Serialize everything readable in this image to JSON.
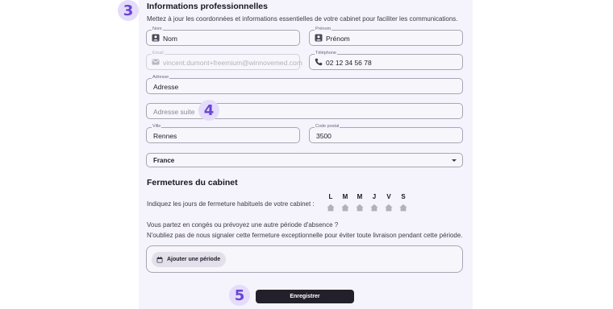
{
  "steps": {
    "s3": "3",
    "s4": "4",
    "s5": "5"
  },
  "section": {
    "title": "Informations professionnelles",
    "subtitle": "Mettez à jour les coordonnées et informations essentielles de votre cabinet pour faciliter les communications."
  },
  "fields": {
    "nom": {
      "label": "Nom",
      "value": "Nom",
      "icon": "person-card-icon"
    },
    "prenom": {
      "label": "Prénom",
      "value": "Prénom",
      "icon": "person-card-icon"
    },
    "email": {
      "label": "Email",
      "value": "vincent.dumont+freemium@winnovemed.com",
      "icon": "mail-icon"
    },
    "telephone": {
      "label": "Téléphone",
      "value": "02 12 34 56 78",
      "icon": "phone-icon"
    },
    "adresse": {
      "label": "Adresse",
      "value": "Adresse"
    },
    "adresse_suite": {
      "placeholder": "Adresse suite"
    },
    "ville": {
      "label": "Ville",
      "value": "Rennes"
    },
    "code_postal": {
      "label": "Code postal",
      "value": "3500"
    },
    "pays": {
      "value": "France"
    }
  },
  "closures": {
    "title": "Fermetures du cabinet",
    "weekly_prompt": "Indiquez les jours de fermeture habituels de votre cabinet :",
    "days": [
      "L",
      "M",
      "M",
      "J",
      "V",
      "S"
    ],
    "absence_line1": "Vous partez en congés ou prévoyez une autre période d'absence ?",
    "absence_line2": "N'oubliez pas de nous signaler cette fermeture exceptionnelle pour éviter toute livraison pendant cette période.",
    "add_period_label": "Ajouter une période"
  },
  "save_label": "Enregistrer",
  "colors": {
    "accent": "#6a45d6",
    "step_bg": "#e4dcfa",
    "panel_bg": "#f5f3fb",
    "button_dark": "#23202b"
  }
}
